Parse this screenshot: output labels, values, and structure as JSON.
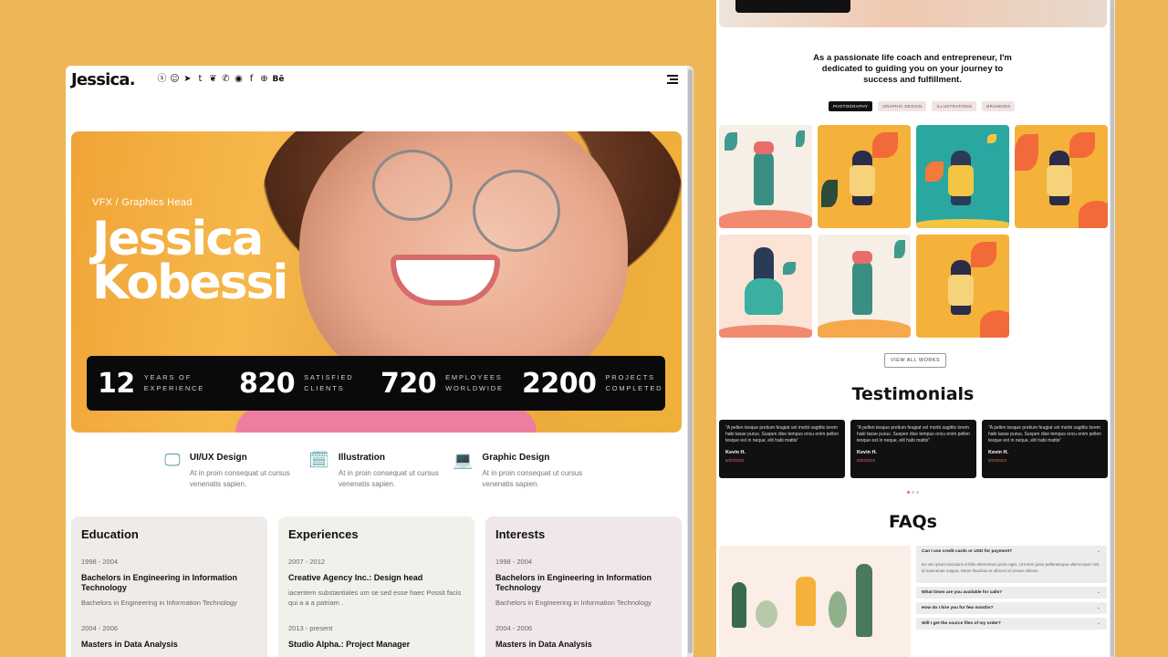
{
  "left": {
    "logo": "Jessica.",
    "socials": [
      {
        "icon": "skype-icon",
        "glyph": "ⓢ"
      },
      {
        "icon": "snapchat-icon",
        "glyph": "☺"
      },
      {
        "icon": "telegram-icon",
        "glyph": "➤"
      },
      {
        "icon": "tumblr-icon",
        "glyph": "t"
      },
      {
        "icon": "twitter-icon",
        "glyph": "❦"
      },
      {
        "icon": "whatsapp-icon",
        "glyph": "✆"
      },
      {
        "icon": "github-icon",
        "glyph": "◉"
      },
      {
        "icon": "facebook-icon",
        "glyph": "f"
      },
      {
        "icon": "messenger-icon",
        "glyph": "⊕"
      },
      {
        "icon": "behance-icon",
        "glyph": "Bē"
      }
    ],
    "hero": {
      "role": "VFX / Graphics Head",
      "name_line1": "Jessica",
      "name_line2": "Kobessi",
      "stats": [
        {
          "number": "12",
          "label_line1": "YEARS OF",
          "label_line2": "EXPERIENCE"
        },
        {
          "number": "820",
          "label_line1": "SATISFIED",
          "label_line2": "CLIENTS"
        },
        {
          "number": "720",
          "label_line1": "EMPLOYEES",
          "label_line2": "WORLDWIDE"
        },
        {
          "number": "2200",
          "label_line1": "PROJECTS",
          "label_line2": "COMPLETED"
        }
      ]
    },
    "services": [
      {
        "icon": "monitor-icon",
        "glyph": "🖵",
        "title": "UI/UX Design",
        "desc": "At in proin consequat ut cursus venenatis sapien."
      },
      {
        "icon": "calendar-icon",
        "glyph": "🗓",
        "title": "Illustration",
        "desc": "At in proin consequat ut cursus venenatis sapien."
      },
      {
        "icon": "laptop-icon",
        "glyph": "💻",
        "title": "Graphic Design",
        "desc": "At in proin consequat ut cursus venenatis sapien."
      }
    ],
    "cards": [
      {
        "title": "Education",
        "entries": [
          {
            "date": "1998 - 2004",
            "title": "Bachelors in Engineering in Information Technology",
            "desc": "Bachelors in Engineering in Information Technology"
          },
          {
            "date": "2004 - 2006",
            "title": "Masters in Data Analysis",
            "desc": ""
          }
        ]
      },
      {
        "title": "Experiences",
        "entries": [
          {
            "date": "2007 - 2012",
            "title": "Creative Agency Inc.: Design head",
            "desc": "iacentem substantiales um se sed esse haec Possit facis qui a a a patriam ."
          },
          {
            "date": "2013 - present",
            "title": "Studio Alpha.: Project Manager",
            "desc": ""
          }
        ]
      },
      {
        "title": "Interests",
        "entries": [
          {
            "date": "1998 - 2004",
            "title": "Bachelors in Engineering in Information Technology",
            "desc": "Bachelors in Engineering in Information Technology"
          },
          {
            "date": "2004 - 2006",
            "title": "Masters in Data Analysis",
            "desc": ""
          }
        ]
      }
    ]
  },
  "right": {
    "intro": "As a passionate life coach and entrepreneur, I'm dedicated to guiding you on your journey to success and fulfillment.",
    "filters": [
      "PHOTOGRAPHY",
      "GRAPHIC DESIGN",
      "ILLUSTRATIONS",
      "BRANDING"
    ],
    "active_filter": 0,
    "view_all": "VIEW ALL WORKS",
    "testimonials_title": "Testimonials",
    "testimonials": [
      {
        "quote": "\"A pellen tesque pretium feugiat vel morbi sagittis lorem habi tasse purus. Suspen dise tempus oncu enim pellen tesque est in neque, elit habi mattis\"",
        "author": "Kevin H.",
        "date": "8/20/2023"
      },
      {
        "quote": "\"A pellen tesque pretium feugiat vel morbi sagittis lorem habi tasse purus. Suspen dise tempus oncu enim pellen tesque est in neque, elit habi mattis\"",
        "author": "Kevin H.",
        "date": "8/20/2023"
      },
      {
        "quote": "\"A pellen tesque pretium feugiat vel morbi sagittis lorem habi tasse purus. Suspen dise tempus oncu enim pellen tesque est in neque, elit habi mattis\"",
        "author": "Kevin H.",
        "date": "8/20/2023"
      }
    ],
    "faq_title": "FAQs",
    "faqs": [
      {
        "q": "Can I use credit cards or USD for payment?",
        "a": "Ex nec ipsum tincidunt ut felis elementum proin eget. Ut lorem justo pellentesque ullamcorper nisl, id maecenas magna. Etiam faucibus et ultrices id ornare ultrices.",
        "open": true
      },
      {
        "q": "What times are you available for calls?",
        "a": "",
        "open": false
      },
      {
        "q": "How do I hire you for few months?",
        "a": "",
        "open": false
      },
      {
        "q": "Will I get the source files of my order?",
        "a": "",
        "open": false
      }
    ]
  },
  "colors": {
    "background": "#EFB657",
    "accent": "#4f9aa7",
    "dark": "#0a0a0a",
    "date_red": "#e26a6a"
  }
}
